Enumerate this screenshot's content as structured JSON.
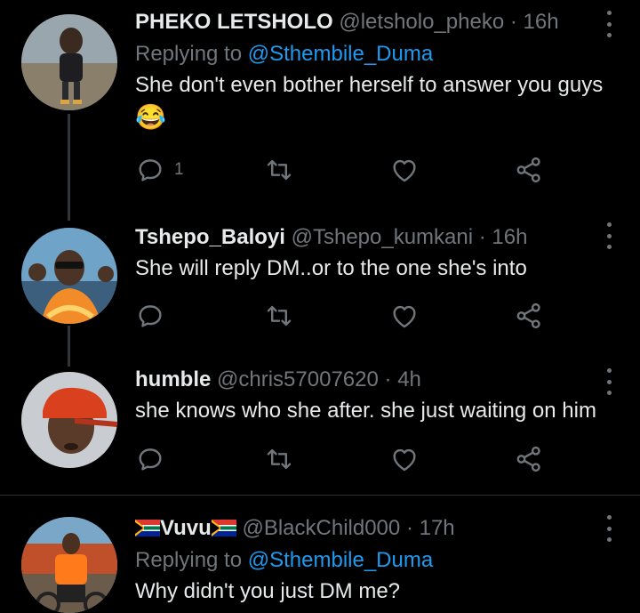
{
  "tweets": [
    {
      "name": "PHEKO LETSHOLO",
      "handle": "@letsholo_pheko",
      "sep": "·",
      "time": "16h",
      "replying_prefix": "Replying to ",
      "replying_to": "@Sthembile_Duma",
      "text": "She don't even bother herself to answer you guys",
      "emoji": "😂",
      "reply_count": "1"
    },
    {
      "name": "Tshepo_Baloyi",
      "handle": "@Tshepo_kumkani",
      "sep": "·",
      "time": "16h",
      "text": "She will reply DM..or to the one she's into"
    },
    {
      "name": "humble",
      "handle": "@chris57007620",
      "sep": "·",
      "time": "4h",
      "text": "she knows who she after. she just waiting on him"
    },
    {
      "name": "Vuvu",
      "handle": "@BlackChild000",
      "sep": "·",
      "time": "17h",
      "replying_prefix": "Replying to ",
      "replying_to": "@Sthembile_Duma",
      "text": "Why didn't you just DM me?"
    }
  ],
  "icons": {
    "reply": "reply-icon",
    "retweet": "retweet-icon",
    "like": "heart-icon",
    "share": "share-icon",
    "more": "more-icon"
  },
  "colors": {
    "background": "#000000",
    "text": "#e7e9ea",
    "muted": "#71767b",
    "link": "#1d9bf0",
    "divider": "#2f3336"
  }
}
